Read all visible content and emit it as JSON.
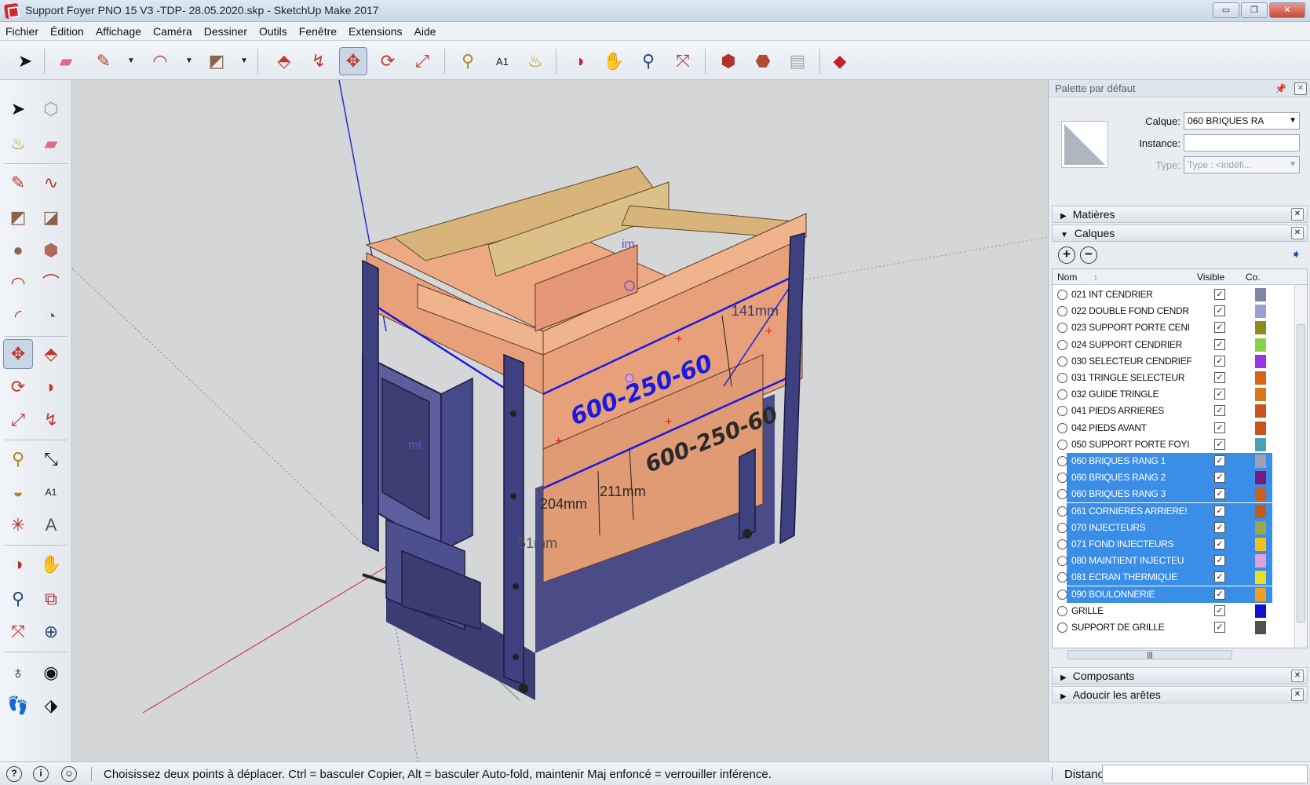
{
  "window": {
    "title": "Support Foyer PNO 15 V3 -TDP- 28.05.2020.skp - SketchUp Make 2017",
    "controls": [
      "minimize",
      "maximize",
      "close"
    ]
  },
  "menu": [
    "Fichier",
    "Édition",
    "Affichage",
    "Caméra",
    "Dessiner",
    "Outils",
    "Fenêtre",
    "Extensions",
    "Aide"
  ],
  "toolbar": {
    "tools": [
      {
        "name": "select-tool",
        "icon": "arrow-icon"
      },
      {
        "name": "eraser-tool",
        "icon": "eraser-icon"
      },
      {
        "name": "line-tool",
        "icon": "pencil-icon"
      },
      {
        "name": "arc-tool",
        "icon": "arc-icon"
      },
      {
        "name": "rectangle-tool",
        "icon": "rectangle-icon"
      },
      {
        "name": "push-pull-tool",
        "icon": "push-pull-icon"
      },
      {
        "name": "offset-tool",
        "icon": "offset-icon"
      },
      {
        "name": "move-tool",
        "icon": "move-icon",
        "active": true
      },
      {
        "name": "rotate-tool",
        "icon": "rotate-icon"
      },
      {
        "name": "scale-tool",
        "icon": "scale-icon"
      },
      {
        "name": "tape-measure-tool",
        "icon": "tape-icon"
      },
      {
        "name": "text-tool",
        "icon": "text-icon"
      },
      {
        "name": "paint-bucket-tool",
        "icon": "paint-bucket-icon"
      },
      {
        "name": "orbit-tool",
        "icon": "orbit-icon"
      },
      {
        "name": "pan-tool",
        "icon": "hand-icon"
      },
      {
        "name": "zoom-tool",
        "icon": "zoom-icon"
      },
      {
        "name": "zoom-extents-tool",
        "icon": "zoom-extents-icon"
      },
      {
        "name": "warehouse-tool",
        "icon": "warehouse-icon"
      },
      {
        "name": "share-model-tool",
        "icon": "share-icon"
      },
      {
        "name": "get-models-tool",
        "icon": "models-icon"
      },
      {
        "name": "extension-warehouse-tool",
        "icon": "ruby-icon"
      }
    ]
  },
  "viewport": {
    "labels": {
      "brick_a": "600-250-60",
      "brick_b": "600-250-60",
      "dim_141": "141mm",
      "dim_211": "211mm",
      "dim_204": "204mm",
      "dim_51": "51mm",
      "dim_top": "im",
      "dim_left": "mi"
    }
  },
  "panel": {
    "title": "Palette par défaut",
    "entity": {
      "layer_label": "Calque:",
      "layer_value": "060 BRIQUES RA",
      "instance_label": "Instance:",
      "instance_value": "",
      "type_label": "Type:",
      "type_value": "Type : <indéfi..."
    },
    "sections": {
      "materials": "Matières",
      "layers": "Calques",
      "components": "Composants",
      "soften": "Adoucir les arêtes"
    },
    "layers": {
      "headers": {
        "name": "Nom",
        "visible": "Visible",
        "color": "Co."
      },
      "rows": [
        {
          "name": "021 INT CENDRIER",
          "visible": true,
          "color": "#7e86a8",
          "selected": false
        },
        {
          "name": "022 DOUBLE FOND CENDR",
          "visible": true,
          "color": "#9aa0d0",
          "selected": false
        },
        {
          "name": "023 SUPPORT PORTE CENI",
          "visible": true,
          "color": "#8f8a1f",
          "selected": false
        },
        {
          "name": "024 SUPPORT CENDRIER",
          "visible": true,
          "color": "#88d34a",
          "selected": false
        },
        {
          "name": "030 SELECTEUR CENDRIEF",
          "visible": true,
          "color": "#9a33e0",
          "selected": false
        },
        {
          "name": "031 TRINGLE SELECTEUR",
          "visible": true,
          "color": "#d86418",
          "selected": false
        },
        {
          "name": "032 GUIDE TRINGLE",
          "visible": true,
          "color": "#d8781e",
          "selected": false
        },
        {
          "name": "041 PIEDS ARRIERES",
          "visible": true,
          "color": "#c8561a",
          "selected": false
        },
        {
          "name": "042 PIEDS AVANT",
          "visible": true,
          "color": "#c8561a",
          "selected": false
        },
        {
          "name": "050 SUPPORT PORTE FOYI",
          "visible": true,
          "color": "#4aa2b8",
          "selected": false
        },
        {
          "name": "060 BRIQUES RANG 1",
          "visible": true,
          "color": "#a0a0b0",
          "selected": true
        },
        {
          "name": "060 BRIQUES RANG 2",
          "visible": true,
          "color": "#7a1a7a",
          "selected": true
        },
        {
          "name": "060 BRIQUES RANG 3",
          "visible": true,
          "color": "#c86020",
          "selected": true
        },
        {
          "name": "061 CORNIERES ARRIERE!",
          "visible": true,
          "color": "#c85a18",
          "selected": true
        },
        {
          "name": "070 INJECTEURS",
          "visible": true,
          "color": "#98a848",
          "selected": true
        },
        {
          "name": "071 FOND INJECTEURS",
          "visible": true,
          "color": "#f0c020",
          "selected": true
        },
        {
          "name": "080 MAINTIENT INJECTEU",
          "visible": true,
          "color": "#e0a0d8",
          "selected": true
        },
        {
          "name": "081 ECRAN THERMIQUE",
          "visible": true,
          "color": "#e8e020",
          "selected": true
        },
        {
          "name": "090 BOULONNERIE",
          "visible": true,
          "color": "#f0a020",
          "selected": true
        },
        {
          "name": "GRILLE",
          "visible": true,
          "color": "#1010d0",
          "selected": false
        },
        {
          "name": "SUPPORT DE GRILLE",
          "visible": true,
          "color": "#505050",
          "selected": false
        }
      ]
    }
  },
  "status": {
    "message": "Choisissez deux points à déplacer.  Ctrl = basculer Copier, Alt = basculer Auto-fold, maintenir Maj enfoncé = verrouiller inférence.",
    "distance_label": "Distance",
    "distance_value": ""
  }
}
